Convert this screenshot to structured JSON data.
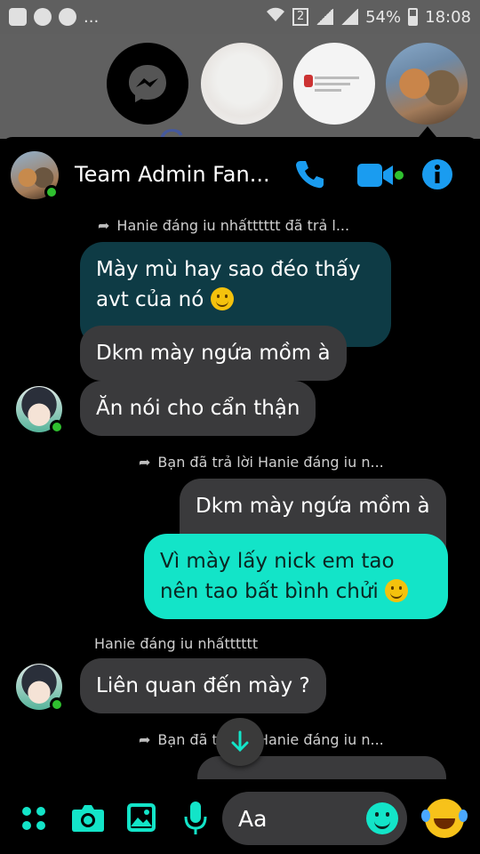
{
  "status_bar": {
    "dots": "...",
    "sim": "2",
    "battery": "54%",
    "time": "18:08"
  },
  "chat_heads": [
    {
      "name": "messenger-chat-head"
    },
    {
      "name": "chat-head-2"
    },
    {
      "name": "chat-head-3"
    },
    {
      "name": "chat-head-cats"
    }
  ],
  "header": {
    "title": "Team Admin Fan..."
  },
  "messages": {
    "reply1_note": "Hanie đáng iu nhấtttttt đã trả l...",
    "quoted1": [
      "Mày mù hay sao đéo thấy",
      "avt của nó"
    ],
    "in1": "Dkm mày ngứa mồm à",
    "in2": "Ăn nói cho cẩn thận",
    "reply2_note": "Bạn đã trả lời Hanie đáng iu n...",
    "quoted2": "Dkm mày ngứa mồm à",
    "out1": [
      "Vì mày lấy nick em tao",
      "nên tao bất bình chửi"
    ],
    "sender_name": "Hanie đáng iu nhấtttttt",
    "in3": "Liên quan đến mày ?",
    "reply3_note": "Bạn đã trả lời Hanie đáng iu n..."
  },
  "composer": {
    "placeholder": "Aa"
  },
  "colors": {
    "accent": "#13e4c8",
    "messenger_blue": "#1a9cf0",
    "bubble_gray": "#3a3a3c",
    "quoted_bg": "#0e3b45"
  }
}
